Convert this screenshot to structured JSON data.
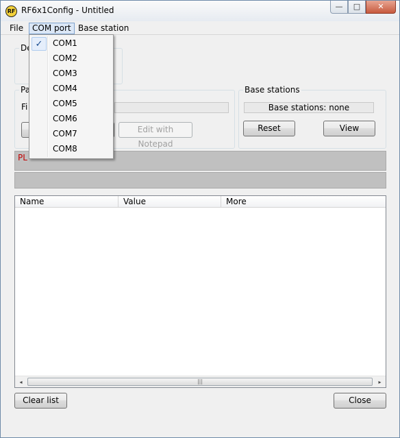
{
  "window": {
    "title": "RF6x1Config - Untitled",
    "icon_text": "RF"
  },
  "caption": {
    "minimize": "—",
    "maximize": "□",
    "close": "✕"
  },
  "menubar": {
    "file": "File",
    "com_port": "COM port",
    "base_station": "Base station"
  },
  "com_menu": {
    "items": [
      {
        "label": "COM1",
        "checked": true,
        "check": "✓"
      },
      {
        "label": "COM2"
      },
      {
        "label": "COM3"
      },
      {
        "label": "COM4"
      },
      {
        "label": "COM5"
      },
      {
        "label": "COM6"
      },
      {
        "label": "COM7"
      },
      {
        "label": "COM8"
      }
    ]
  },
  "device_group": {
    "legend_partial": "De"
  },
  "params_group": {
    "legend_partial": "Pa",
    "field_label_partial": "Fi",
    "edit_button": "Edit with Notepad"
  },
  "base_stations_group": {
    "legend": "Base stations",
    "status": "Base stations: none",
    "reset_button": "Reset",
    "view_button": "View"
  },
  "status": {
    "text_partial": "PL"
  },
  "list": {
    "columns": [
      "Name",
      "Value",
      "More"
    ],
    "rows": []
  },
  "scrollbar": {
    "left_arrow": "◂",
    "right_arrow": "▸",
    "grip": "|||"
  },
  "footer": {
    "clear_list": "Clear list",
    "close": "Close"
  },
  "colors": {
    "accent": "#7da2ce",
    "status_text": "#c00000",
    "status_band": "#c0c0c0"
  }
}
